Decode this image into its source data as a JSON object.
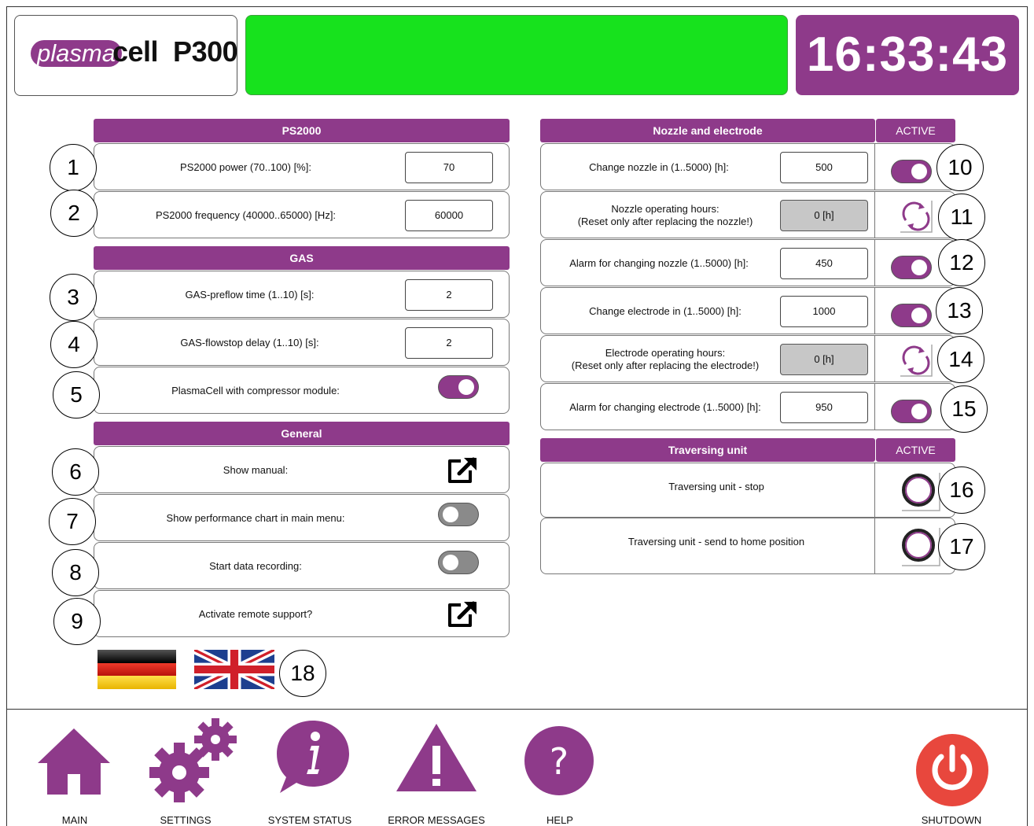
{
  "header": {
    "logo_pill": "plasma",
    "logo_text": "cell  P300",
    "status_text": "",
    "clock": "16:33:43"
  },
  "ps2000": {
    "title": "PS2000",
    "rows": [
      {
        "label": "PS2000 power (70..100) [%]:",
        "value": "70"
      },
      {
        "label": "PS2000 frequency (40000..65000) [Hz]:",
        "value": "60000"
      }
    ]
  },
  "gas": {
    "title": "GAS",
    "rows": [
      {
        "label": "GAS-preflow time (1..10) [s]:",
        "value": "2"
      },
      {
        "label": "GAS-flowstop delay (1..10) [s]:",
        "value": "2"
      }
    ],
    "compressor": {
      "label": "PlasmaCell with compressor module:",
      "state": "on"
    }
  },
  "general": {
    "title": "General",
    "rows": [
      {
        "label": "Show manual:",
        "control": "external-link"
      },
      {
        "label": "Show performance chart in main menu:",
        "control": "toggle",
        "state": "off"
      },
      {
        "label": "Start data recording:",
        "control": "toggle",
        "state": "off"
      },
      {
        "label": "Activate remote support?",
        "control": "external-link"
      }
    ]
  },
  "nozzle": {
    "title": "Nozzle and electrode",
    "active_header": "ACTIVE",
    "rows": [
      {
        "label": "Change nozzle in (1..5000) [h]:",
        "value": "500",
        "control": "toggle-on"
      },
      {
        "label": "Nozzle operating hours:",
        "label2": "(Reset only after replacing the nozzle!)",
        "value": "0 [h]",
        "control": "reset"
      },
      {
        "label": "Alarm for changing nozzle (1..5000) [h]:",
        "value": "450",
        "control": "toggle-on"
      },
      {
        "label": "Change electrode in (1..5000) [h]:",
        "value": "1000",
        "control": "toggle-on"
      },
      {
        "label": "Electrode operating hours:",
        "label2": "(Reset only after replacing the electrode!)",
        "value": "0 [h]",
        "control": "reset"
      },
      {
        "label": "Alarm for changing electrode (1..5000) [h]:",
        "value": "950",
        "control": "toggle-on"
      }
    ]
  },
  "traversing": {
    "title": "Traversing unit",
    "active_header": "ACTIVE",
    "rows": [
      {
        "label": "Traversing unit - stop"
      },
      {
        "label": "Traversing unit - send to home position"
      }
    ]
  },
  "languages": [
    "german-flag",
    "uk-flag"
  ],
  "markers": [
    "1",
    "2",
    "3",
    "4",
    "5",
    "6",
    "7",
    "8",
    "9",
    "10",
    "11",
    "12",
    "13",
    "14",
    "15",
    "16",
    "17",
    "18"
  ],
  "nav": {
    "main": "MAIN",
    "settings": "SETTINGS",
    "system_status": "SYSTEM STATUS",
    "error_messages": "ERROR MESSAGES",
    "help": "HELP",
    "shutdown": "SHUTDOWN"
  },
  "colors": {
    "accent": "#8e3a8a",
    "status_green": "#17e21d",
    "shutdown_red": "#e8473d",
    "value_grey": "#c7c7c7"
  }
}
